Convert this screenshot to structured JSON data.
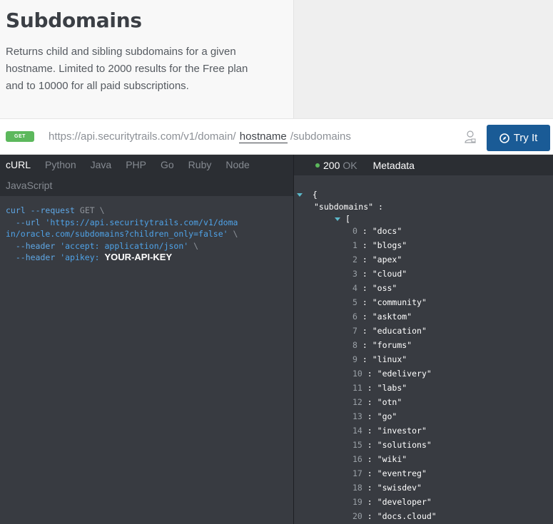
{
  "header": {
    "title": "Subdomains",
    "description": "Returns child and sibling subdomains for a given hostname. Limited to 2000 results for the Free plan and to 10000 for all paid subscriptions."
  },
  "request": {
    "method": "GET",
    "url_prefix": "https://api.securitytrails.com/v1/domain/",
    "param": "hostname",
    "url_suffix": "/subdomains",
    "try_label": "Try It"
  },
  "languages": [
    "cURL",
    "Python",
    "Java",
    "PHP",
    "Go",
    "Ruby",
    "Node",
    "JavaScript"
  ],
  "code": {
    "l1_cmd": "curl",
    "l1_flag": "--request",
    "l1_method": "GET",
    "l2_flag": "--url",
    "l2_str_a": "'https://api.securitytrails.com/v1/doma",
    "l3_str_b": "in/oracle.com/subdomains?children_only=false'",
    "l4_flag": "--header",
    "l4_str": "'accept: application/json'",
    "l5_flag": "--header",
    "l5_str": "'apikey:",
    "l5_key": "YOUR-API-KEY",
    "cont": "\\"
  },
  "response": {
    "status_code": "200",
    "status_text": "OK",
    "metadata_label": "Metadata",
    "open_brace": "{",
    "key": "\"subdomains\"",
    "colon": ":",
    "open_bracket": "[",
    "items": [
      {
        "i": "0",
        "v": "\"docs\""
      },
      {
        "i": "1",
        "v": "\"blogs\""
      },
      {
        "i": "2",
        "v": "\"apex\""
      },
      {
        "i": "3",
        "v": "\"cloud\""
      },
      {
        "i": "4",
        "v": "\"oss\""
      },
      {
        "i": "5",
        "v": "\"community\""
      },
      {
        "i": "6",
        "v": "\"asktom\""
      },
      {
        "i": "7",
        "v": "\"education\""
      },
      {
        "i": "8",
        "v": "\"forums\""
      },
      {
        "i": "9",
        "v": "\"linux\""
      },
      {
        "i": "10",
        "v": "\"edelivery\""
      },
      {
        "i": "11",
        "v": "\"labs\""
      },
      {
        "i": "12",
        "v": "\"otn\""
      },
      {
        "i": "13",
        "v": "\"go\""
      },
      {
        "i": "14",
        "v": "\"investor\""
      },
      {
        "i": "15",
        "v": "\"solutions\""
      },
      {
        "i": "16",
        "v": "\"wiki\""
      },
      {
        "i": "17",
        "v": "\"eventreg\""
      },
      {
        "i": "18",
        "v": "\"swisdev\""
      },
      {
        "i": "19",
        "v": "\"developer\""
      },
      {
        "i": "20",
        "v": "\"docs.cloud\""
      }
    ]
  },
  "icons": {
    "user": "user-icon",
    "try": "compass-icon"
  },
  "colors": {
    "try_button": "#1a5b96",
    "method_badge": "#5cb85c",
    "status_dot": "#5cb85c"
  }
}
